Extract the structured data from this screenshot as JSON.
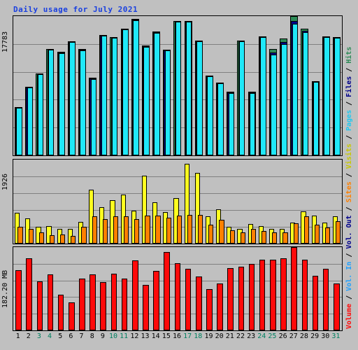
{
  "title": "Daily usage for July 2021",
  "axis": {
    "hits_max_label": "17783",
    "sites_max_label": "1926",
    "volume_max_label": "182.20 MB"
  },
  "legend": {
    "items": [
      {
        "label": "Volume",
        "color": "#ff0a0a"
      },
      {
        "label": "Vol. In",
        "color": "#20a0ff"
      },
      {
        "label": "Vol. Out",
        "color": "#00008b"
      },
      {
        "label": "Sites",
        "color": "#ff8000"
      },
      {
        "label": "Visits",
        "color": "#c8c800"
      },
      {
        "label": "Pages",
        "color": "#20c8f0"
      },
      {
        "label": "Files",
        "color": "#00008b"
      },
      {
        "label": "Hits",
        "color": "#2e8b57"
      }
    ],
    "separator": " / "
  },
  "colors": {
    "background": "#c0c0c0",
    "title": "#1a40e0",
    "grid": "#808080",
    "hits": "#2e8b57",
    "files": "#00008b",
    "pages": "#20e8f8",
    "visits": "#ffff20",
    "sites": "#ff8000",
    "volume": "#ff0a0a",
    "weekday_label": "#000000",
    "weekend_label": "#008060"
  },
  "chart_data": {
    "type": "bar",
    "title": "Daily usage for July 2021",
    "xlabel": "",
    "categories": [
      "1",
      "2",
      "3",
      "4",
      "5",
      "6",
      "7",
      "8",
      "9",
      "10",
      "11",
      "12",
      "13",
      "14",
      "15",
      "16",
      "17",
      "18",
      "19",
      "20",
      "21",
      "22",
      "23",
      "24",
      "25",
      "26",
      "27",
      "28",
      "29",
      "30",
      "31"
    ],
    "weekend_days": [
      3,
      4,
      10,
      11,
      17,
      18,
      24,
      25,
      31
    ],
    "panels": [
      {
        "name": "hits-files-pages",
        "ylabel": "Hits / Files / Pages",
        "ylim": [
          0,
          17783
        ],
        "ymax_label": "17783",
        "gridlines": 4,
        "series": [
          {
            "name": "Hits",
            "color": "#2e8b57",
            "values": [
              6170,
              8800,
              10500,
              13600,
              13200,
              14600,
              13550,
              9900,
              15400,
              15100,
              16200,
              17400,
              14000,
              15800,
              13500,
              17200,
              17200,
              14700,
              10200,
              9300,
              8100,
              14700,
              8100,
              15200,
              13600,
              14900,
              17783,
              16200,
              9500,
              15200,
              15100
            ]
          },
          {
            "name": "Files",
            "color": "#00008b",
            "values": [
              6100,
              8700,
              10420,
              13520,
              13120,
              14520,
              13470,
              9820,
              15320,
              15020,
              16120,
              17320,
              13920,
              15720,
              13420,
              17120,
              17120,
              14620,
              10120,
              9220,
              8020,
              14620,
              8020,
              15120,
              13120,
              14450,
              17200,
              15900,
              9400,
              15120,
              15020
            ]
          },
          {
            "name": "Pages",
            "color": "#20e8f8",
            "values": [
              6050,
              8650,
              10380,
              13480,
              13080,
              14480,
              13430,
              9780,
              15280,
              14980,
              16080,
              17280,
              13880,
              15680,
              13380,
              17080,
              17080,
              14580,
              10080,
              9180,
              7980,
              14580,
              7980,
              15080,
              12900,
              14250,
              16800,
              15750,
              9350,
              15080,
              14980
            ]
          }
        ]
      },
      {
        "name": "sites-visits",
        "ylabel": "Sites / Visits",
        "ylim": [
          0,
          1926
        ],
        "ymax_label": "1926",
        "gridlines": 4,
        "series": [
          {
            "name": "Visits",
            "color": "#ffff20",
            "values": [
              700,
              580,
              380,
              400,
              330,
              330,
              500,
              1240,
              830,
              1000,
              1130,
              760,
              1560,
              950,
              720,
              1040,
              1830,
              1620,
              620,
              790,
              390,
              330,
              450,
              400,
              330,
              330,
              480,
              740,
              640,
              480,
              620
            ]
          },
          {
            "name": "Sites",
            "color": "#ff8000",
            "values": [
              380,
              330,
              250,
              190,
              210,
              180,
              380,
              620,
              560,
              620,
              630,
              560,
              640,
              640,
              600,
              640,
              660,
              660,
              440,
              540,
              310,
              260,
              330,
              290,
              250,
              250,
              470,
              620,
              440,
              370,
              520
            ]
          }
        ]
      },
      {
        "name": "volume",
        "ylabel": "Volume",
        "ylim": [
          0,
          182.2
        ],
        "ymax_label": "182.20 MB",
        "unit": "MB",
        "gridlines": 4,
        "series": [
          {
            "name": "Volume",
            "color": "#ff0a0a",
            "values": [
              132,
              158,
              107,
              123,
              78,
              62,
              114,
              122,
              105,
              124,
              113,
              153,
              100,
              130,
              171,
              147,
              135,
              118,
              90,
              103,
              136,
              140,
              146,
              155,
              155,
              158,
              182,
              154,
              120,
              135,
              103
            ]
          }
        ]
      }
    ]
  }
}
